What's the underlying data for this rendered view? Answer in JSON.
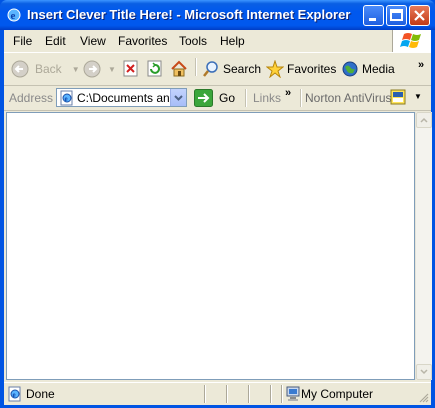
{
  "window": {
    "title": "Insert Clever Title Here! - Microsoft Internet Explorer"
  },
  "menu": [
    "File",
    "Edit",
    "View",
    "Favorites",
    "Tools",
    "Help"
  ],
  "toolbar": {
    "back_label": "Back",
    "search_label": "Search",
    "favorites_label": "Favorites",
    "media_label": "Media"
  },
  "addressbar": {
    "label": "Address",
    "url": "C:\\Documents and Settings",
    "go_label": "Go",
    "links_label": "Links",
    "norton_label": "Norton AntiVirus"
  },
  "statusbar": {
    "status": "Done",
    "zone": "My Computer"
  },
  "colors": {
    "titlebar": "#0058ee",
    "chrome": "#ece9d8",
    "content": "#ffffff"
  }
}
